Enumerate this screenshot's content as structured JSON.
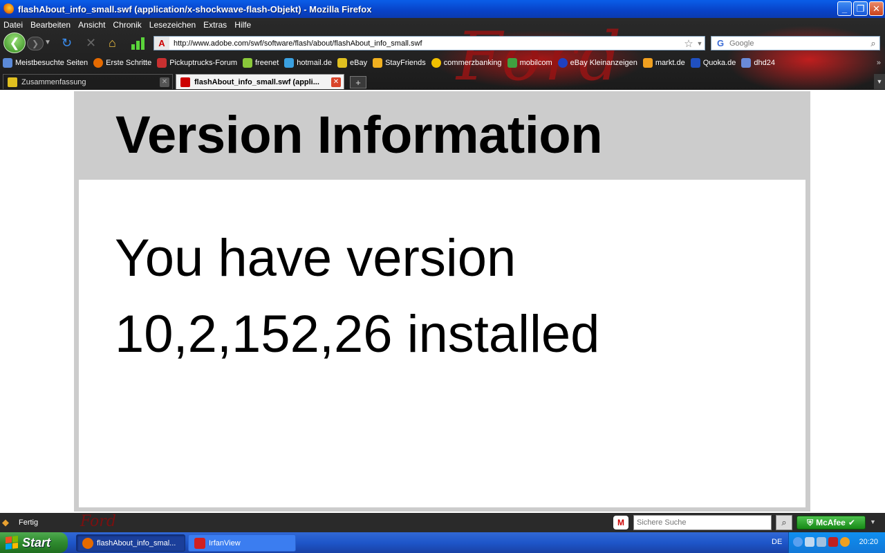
{
  "window": {
    "title": "flashAbout_info_small.swf (application/x-shockwave-flash-Objekt) - Mozilla Firefox",
    "minimize": "_",
    "maximize": "❐",
    "close": "✕"
  },
  "menu": [
    "Datei",
    "Bearbeiten",
    "Ansicht",
    "Chronik",
    "Lesezeichen",
    "Extras",
    "Hilfe"
  ],
  "nav": {
    "url": "http://www.adobe.com/swf/software/flash/about/flashAbout_info_small.swf",
    "search_placeholder": "Google"
  },
  "bookmarks": [
    {
      "label": "Meistbesuchte Seiten",
      "color": "#5b8ad8"
    },
    {
      "label": "Erste Schritte",
      "color": "#e56a00"
    },
    {
      "label": "Pickuptrucks-Forum",
      "color": "#c83030"
    },
    {
      "label": "freenet",
      "color": "#8ac83a"
    },
    {
      "label": "hotmail.de",
      "color": "#3aa0e0"
    },
    {
      "label": "eBay",
      "color": "#e0c020"
    },
    {
      "label": "StayFriends",
      "color": "#f0b020"
    },
    {
      "label": "commerzbanking",
      "color": "#f0c000"
    },
    {
      "label": "mobilcom",
      "color": "#40a040"
    },
    {
      "label": "eBay Kleinanzeigen",
      "color": "#2040c0"
    },
    {
      "label": "markt.de",
      "color": "#f0a020"
    },
    {
      "label": "Quoka.de",
      "color": "#2050c0"
    },
    {
      "label": "dhd24",
      "color": "#6a8ad8"
    }
  ],
  "tabs": [
    {
      "label": "Zusammenfassung",
      "active": false
    },
    {
      "label": "flashAbout_info_small.swf (appli...",
      "active": true
    }
  ],
  "content": {
    "title": "Version Information",
    "line1": "You have version",
    "line2": "10,2,152,26 installed"
  },
  "status": {
    "text": "Fertig",
    "safe_search_placeholder": "Sichere Suche",
    "mcafee": "McAfee"
  },
  "taskbar": {
    "start": "Start",
    "items": [
      {
        "label": "flashAbout_info_smal...",
        "active": true
      },
      {
        "label": "IrfanView",
        "active": false
      }
    ],
    "lang": "DE",
    "clock": "20:20"
  }
}
